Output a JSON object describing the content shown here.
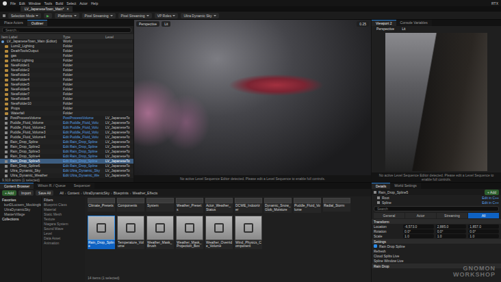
{
  "window": {
    "title": "LV_JapaneseTown_Main*",
    "right_label": "RTX",
    "close": "×"
  },
  "menu": [
    "File",
    "Edit",
    "Window",
    "Tools",
    "Build",
    "Select",
    "Actor",
    "Help"
  ],
  "toolbar": {
    "mode": "Selection Mode",
    "play": "▶",
    "buttons": [
      "Platforms",
      "Pixel Streaming",
      "Pixel Streaming",
      "VP Roles",
      "Ultra Dynamic Sky"
    ]
  },
  "outliner": {
    "tabs": [
      {
        "label": "Place Actors",
        "selected": false
      },
      {
        "label": "Outliner",
        "selected": true
      }
    ],
    "search": {
      "placeholder": "Search..."
    },
    "columns": [
      "Item Label",
      "Type",
      "Level"
    ],
    "rows": [
      {
        "label": "LV_JapaneseTown_Main (Editor)",
        "type": "World",
        "level": "",
        "kind": "world",
        "selected": false
      },
      {
        "label": "Lumi2_Lighting",
        "type": "Folder",
        "level": "",
        "kind": "folder",
        "selected": false
      },
      {
        "label": "DeathToolsOutput",
        "type": "Folder",
        "level": "",
        "kind": "folder",
        "selected": false
      },
      {
        "label": "gas",
        "type": "Folder",
        "level": "",
        "kind": "folder",
        "selected": false
      },
      {
        "label": "zArtful Lighting",
        "type": "Folder",
        "level": "",
        "kind": "folder",
        "selected": false
      },
      {
        "label": "NewFolder1",
        "type": "Folder",
        "level": "",
        "kind": "folder",
        "selected": false
      },
      {
        "label": "NewFolder2",
        "type": "Folder",
        "level": "",
        "kind": "folder",
        "selected": false
      },
      {
        "label": "NewFolder3",
        "type": "Folder",
        "level": "",
        "kind": "folder",
        "selected": false
      },
      {
        "label": "NewFolder4",
        "type": "Folder",
        "level": "",
        "kind": "folder",
        "selected": false
      },
      {
        "label": "NewFolder5",
        "type": "Folder",
        "level": "",
        "kind": "folder",
        "selected": false
      },
      {
        "label": "NewFolder6",
        "type": "Folder",
        "level": "",
        "kind": "folder",
        "selected": false
      },
      {
        "label": "NewFolder7",
        "type": "Folder",
        "level": "",
        "kind": "folder",
        "selected": false
      },
      {
        "label": "NewFolder8",
        "type": "Folder",
        "level": "",
        "kind": "folder",
        "selected": false
      },
      {
        "label": "NewFolder10",
        "type": "Folder",
        "level": "",
        "kind": "folder",
        "selected": false
      },
      {
        "label": "Props",
        "type": "Folder",
        "level": "",
        "kind": "folder",
        "selected": false
      },
      {
        "label": "Waterfall",
        "type": "Folder",
        "level": "",
        "kind": "folder",
        "selected": false
      },
      {
        "label": "PostProcessVolume",
        "type": "PostProcessVolume",
        "level": "LV_JapaneseTo",
        "kind": "actor",
        "selected": false
      },
      {
        "label": "Puddle_Fluid_Volume",
        "type": "Edit Puddle_Fluid_Volu",
        "level": "LV_JapaneseTo",
        "kind": "actor",
        "selected": false
      },
      {
        "label": "Puddle_Fluid_Volume2",
        "type": "Edit Puddle_Fluid_Volu",
        "level": "LV_JapaneseTo",
        "kind": "actor",
        "selected": false
      },
      {
        "label": "Puddle_Fluid_Volume3",
        "type": "Edit Puddle_Fluid_Volu",
        "level": "LV_JapaneseTo",
        "kind": "actor",
        "selected": false
      },
      {
        "label": "Puddle_Fluid_Volume4",
        "type": "Edit Puddle_Fluid_Volu",
        "level": "LV_JapaneseTo",
        "kind": "actor",
        "selected": false
      },
      {
        "label": "Rain_Drop_Spline",
        "type": "Edit Rain_Drop_Spline",
        "level": "LV_JapaneseTo",
        "kind": "actor",
        "selected": false
      },
      {
        "label": "Rain_Drop_Spline2",
        "type": "Edit Rain_Drop_Spline",
        "level": "LV_JapaneseTo",
        "kind": "actor",
        "selected": false
      },
      {
        "label": "Rain_Drop_Spline3",
        "type": "Edit Rain_Drop_Spline",
        "level": "LV_JapaneseTo",
        "kind": "actor",
        "selected": false
      },
      {
        "label": "Rain_Drop_Spline4",
        "type": "Edit Rain_Drop_Spline",
        "level": "LV_JapaneseTo",
        "kind": "actor",
        "selected": false
      },
      {
        "label": "Rain_Drop_Spline5",
        "type": "Edit Rain_Drop_Spline",
        "level": "LV_JapaneseTo",
        "kind": "actor",
        "selected": true
      },
      {
        "label": "Rain_Drop_Spline6",
        "type": "Edit Rain_Drop_Spline",
        "level": "LV_JapaneseTo",
        "kind": "actor",
        "selected": false
      },
      {
        "label": "Ultra_Dynamic_Sky",
        "type": "Edit Ultra_Dynamic_Sky",
        "level": "LV_JapaneseTo",
        "kind": "actor",
        "selected": false
      },
      {
        "label": "Ultra_Dynamic_Weather",
        "type": "Edit Ultra_Dynamic_We",
        "level": "LV_JapaneseTo",
        "kind": "actor",
        "selected": false
      }
    ],
    "footer": "9,919 actors (1 selected)"
  },
  "viewport": {
    "view": "Perspective",
    "mode": "Lit",
    "speed": "0.25",
    "message": "No active Level Sequence Editor detected. Please edit a Level Sequence to enable full controls."
  },
  "viewport2": {
    "tabs": [
      {
        "label": "Viewport 2",
        "selected": true
      },
      {
        "label": "Console Variables",
        "selected": false
      }
    ],
    "view": "Perspective",
    "mode": "Lit",
    "message": "No active Level Sequence Editor detected. Please edit a Level Sequence to enable full controls."
  },
  "content_browser": {
    "tabs": [
      {
        "label": "Content Browser",
        "selected": true
      },
      {
        "label": "Wilson R. / Queue",
        "selected": false
      },
      {
        "label": "Sequencer",
        "selected": false
      }
    ],
    "buttons": [
      "+ Add",
      "Import",
      "Save All"
    ],
    "path": [
      "All",
      "Content",
      "UltraDynamicSky",
      "Blueprints",
      "Weather_Effects"
    ],
    "separator": "›",
    "favorites": {
      "title": "Favorites",
      "items": [
        "kuriDLucsem_Mockingbird",
        "UltraDynamicSky",
        "MasterVillage"
      ]
    },
    "collections": "Collections",
    "filters": {
      "title": "Filters",
      "items": [
        "Blueprint Class",
        "Material",
        "Static Mesh",
        "Texture",
        "Niagara System",
        "Sound Wave",
        "Level",
        "Data Asset",
        "Animation"
      ]
    },
    "assets_top": [
      {
        "label": "Climate_Presets",
        "selected": false
      },
      {
        "label": "Components",
        "selected": false
      },
      {
        "label": "System",
        "selected": false
      },
      {
        "label": "Weather_Presets",
        "selected": false
      },
      {
        "label": "Actor_Weather_Status",
        "selected": false
      },
      {
        "label": "DCWE_Indoorizer",
        "selected": false
      },
      {
        "label": "Dynamic_Snow_Glob_Moisture",
        "selected": false
      },
      {
        "label": "Puddle_Fluid_Volume",
        "selected": false
      },
      {
        "label": "Radial_Storm",
        "selected": false
      }
    ],
    "assets": [
      {
        "label": "Rain_Drop_Spline",
        "selected": true
      },
      {
        "label": "Temperature_Volume",
        "selected": false
      },
      {
        "label": "Weather_Mask_Brush",
        "selected": false
      },
      {
        "label": "Weather_Mask_Projection_Box",
        "selected": false
      },
      {
        "label": "Weather_Override_Volume",
        "selected": false
      },
      {
        "label": "Wind_Physics_Component",
        "selected": false
      }
    ],
    "footer": "14 items (1 selected)"
  },
  "details": {
    "tabs": [
      {
        "label": "Details",
        "selected": true
      },
      {
        "label": "World Settings",
        "selected": false
      }
    ],
    "actor": "Rain_Drop_Spline5",
    "add": "+ Add",
    "components": [
      {
        "name": "Root",
        "action": "Edit in C++"
      },
      {
        "name": "Spline",
        "action": "Edit in C++"
      }
    ],
    "search": {
      "placeholder": "Search"
    },
    "filters": [
      {
        "label": "General",
        "selected": false
      },
      {
        "label": "Actor",
        "selected": false
      },
      {
        "label": "Streaming",
        "selected": false
      },
      {
        "label": "All",
        "selected": true
      }
    ],
    "transform": {
      "title": "Transform",
      "rows": [
        {
          "label": "Location",
          "values": [
            "-6,573.0",
            "2,885.0",
            "1,857.0"
          ]
        },
        {
          "label": "Rotation",
          "values": [
            "0.0°",
            "0.0°",
            "0.0°"
          ]
        },
        {
          "label": "Scale",
          "values": [
            "1.0",
            "1.0",
            "1.0"
          ]
        }
      ]
    },
    "settings": {
      "title": "Settings",
      "checkbox": {
        "label": "Rain Drop Spline",
        "checked": true
      },
      "rows": [
        "Refresh",
        "Cloud Splits Live",
        "Spline Window Live"
      ]
    },
    "bottom_section": "Rain Drop"
  },
  "watermark": "GNOMON WORKSHOP"
}
